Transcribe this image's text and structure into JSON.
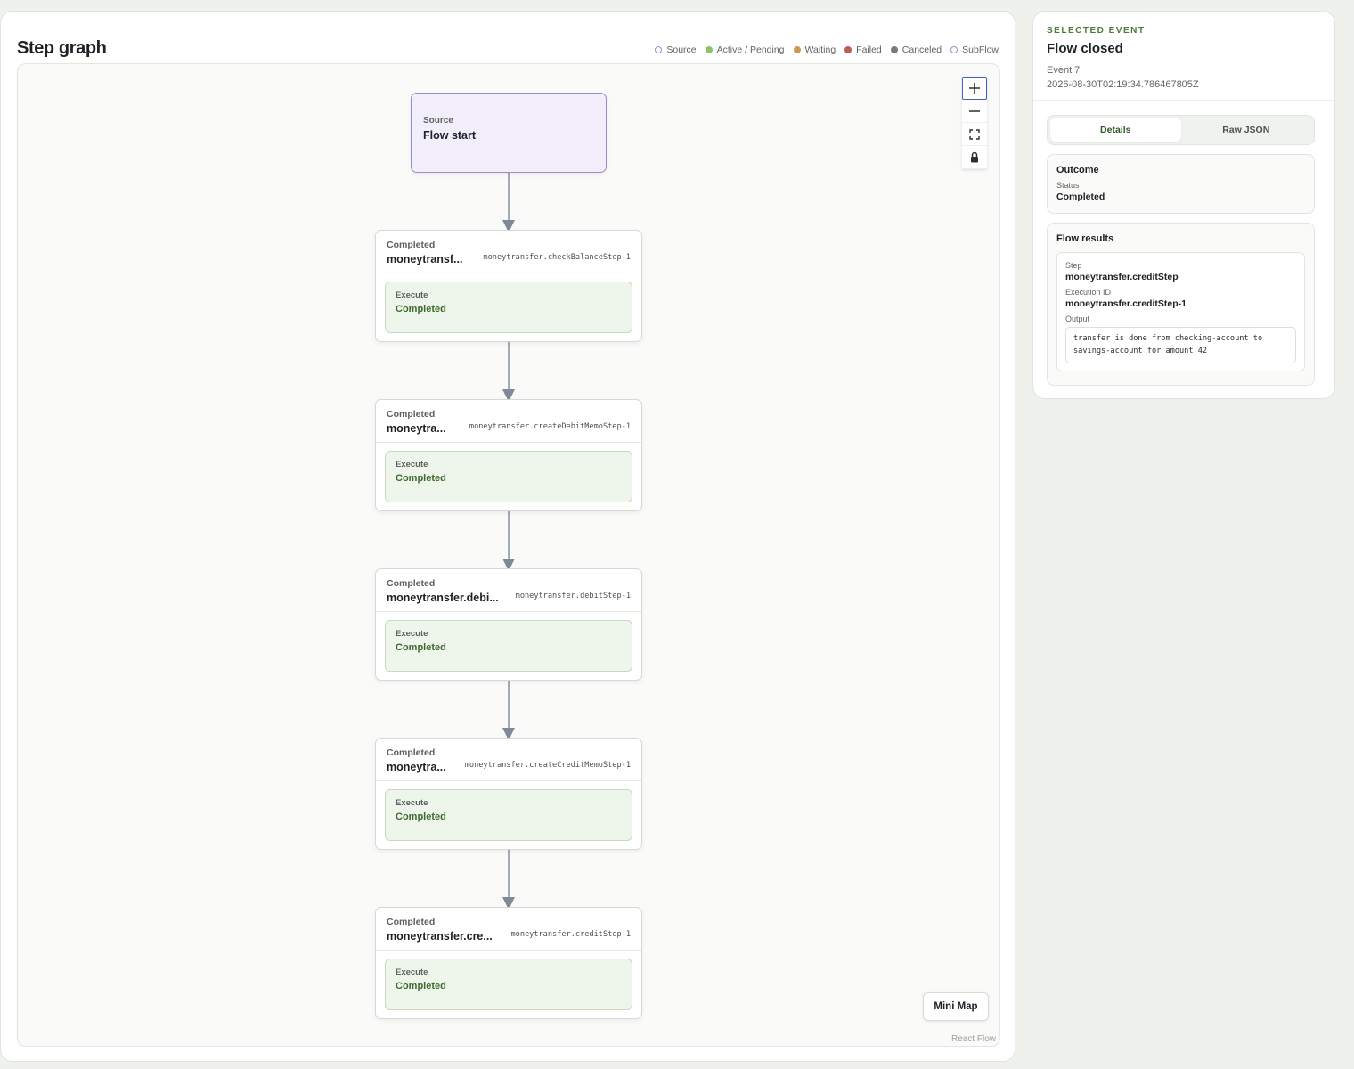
{
  "graph": {
    "title": "Step graph",
    "legend": [
      {
        "label": "Source",
        "color": "#9b8bd0",
        "style": "ring"
      },
      {
        "label": "Active / Pending",
        "color": "#8cc465",
        "style": "dot"
      },
      {
        "label": "Waiting",
        "color": "#c99a4f",
        "style": "dot"
      },
      {
        "label": "Failed",
        "color": "#c05a57",
        "style": "dot"
      },
      {
        "label": "Canceled",
        "color": "#777c78",
        "style": "dot"
      },
      {
        "label": "SubFlow",
        "color": "#8a95c8",
        "style": "ring"
      }
    ],
    "source_node": {
      "kind": "Source",
      "title": "Flow start"
    },
    "steps": [
      {
        "status": "Completed",
        "name": "moneytransf...",
        "id": "moneytransfer.checkBalanceStep-1",
        "exec_label": "Execute",
        "exec_status": "Completed"
      },
      {
        "status": "Completed",
        "name": "moneytra...",
        "id": "moneytransfer.createDebitMemoStep-1",
        "exec_label": "Execute",
        "exec_status": "Completed"
      },
      {
        "status": "Completed",
        "name": "moneytransfer.debi...",
        "id": "moneytransfer.debitStep-1",
        "exec_label": "Execute",
        "exec_status": "Completed"
      },
      {
        "status": "Completed",
        "name": "moneytra...",
        "id": "moneytransfer.createCreditMemoStep-1",
        "exec_label": "Execute",
        "exec_status": "Completed"
      },
      {
        "status": "Completed",
        "name": "moneytransfer.cre...",
        "id": "moneytransfer.creditStep-1",
        "exec_label": "Execute",
        "exec_status": "Completed"
      }
    ],
    "controls": {
      "zoom_in": "+",
      "zoom_out": "−",
      "fit": "⛶",
      "lock": "🔒"
    },
    "minimap_label": "Mini Map",
    "attribution": "React Flow"
  },
  "side": {
    "eyebrow": "SELECTED EVENT",
    "title": "Flow closed",
    "event": "Event 7",
    "timestamp": "2026-08-30T02:19:34.786467805Z",
    "tabs": [
      {
        "label": "Details",
        "active": true
      },
      {
        "label": "Raw JSON",
        "active": false
      }
    ],
    "outcome": {
      "title": "Outcome",
      "status_label": "Status",
      "status_value": "Completed"
    },
    "results": {
      "title": "Flow results",
      "step_label": "Step",
      "step_value": "moneytransfer.creditStep",
      "exec_label": "Execution ID",
      "exec_value": "moneytransfer.creditStep-1",
      "output_label": "Output",
      "output_value": "transfer is done from checking-account to savings-account for amount 42"
    }
  }
}
